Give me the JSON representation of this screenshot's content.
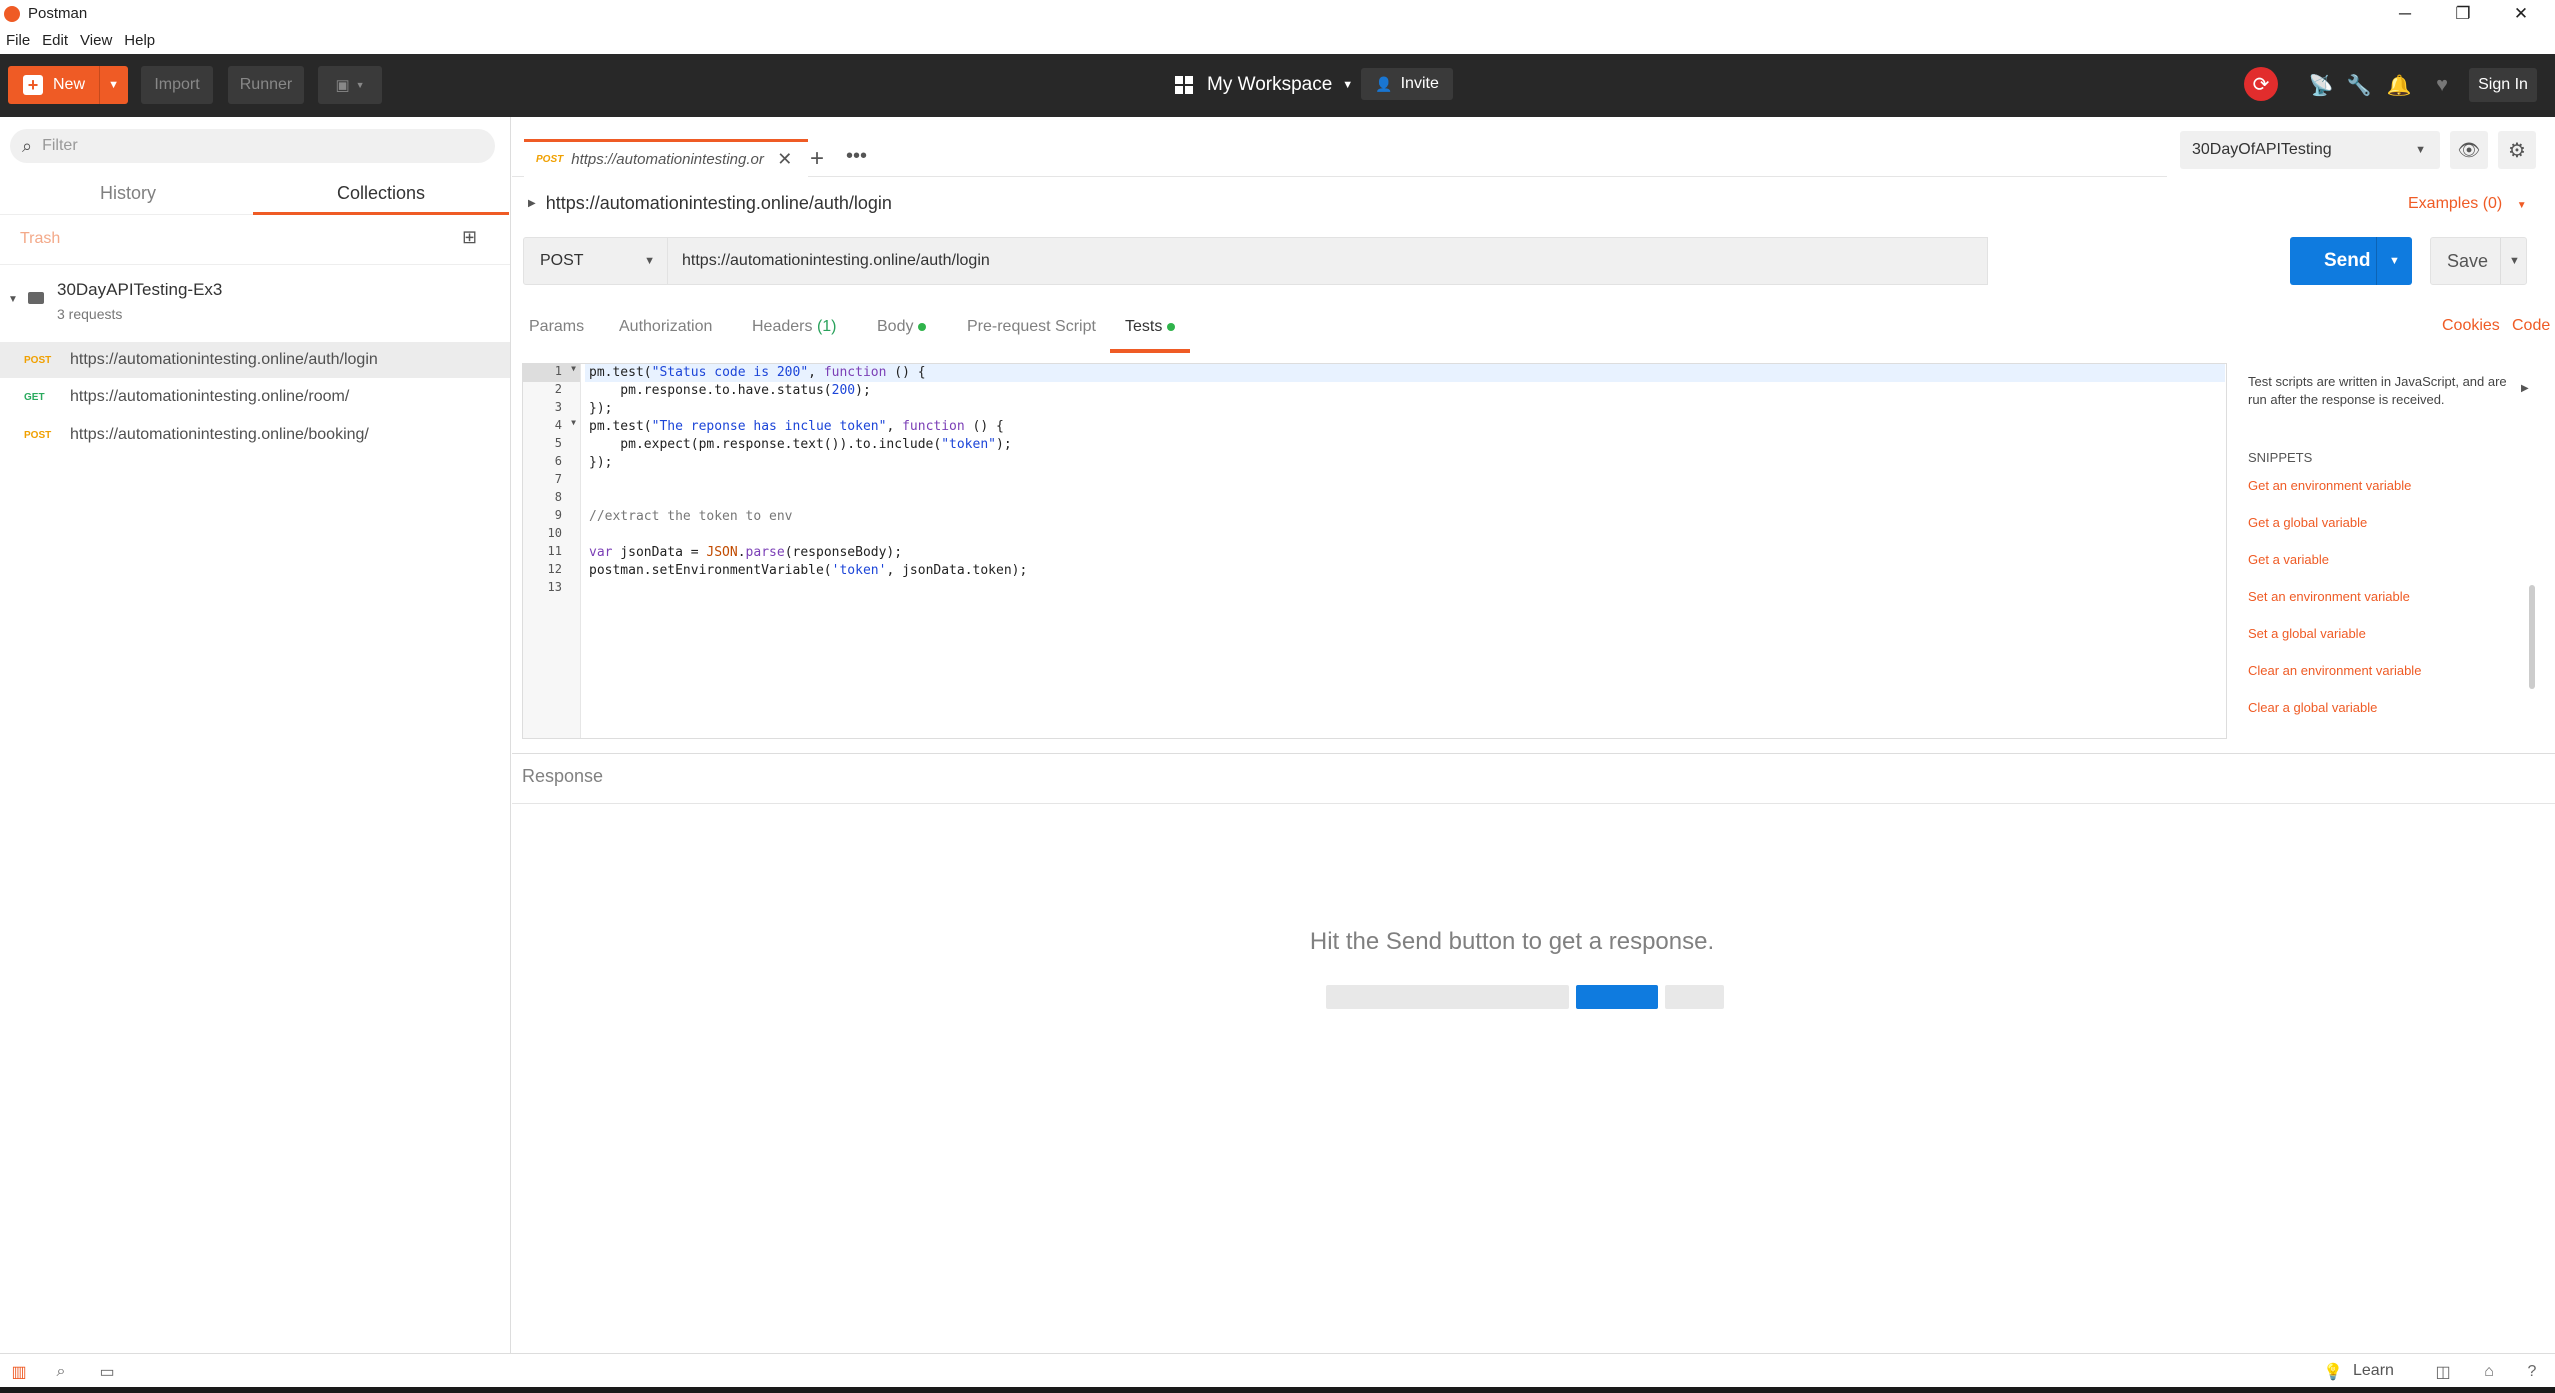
{
  "window": {
    "title": "Postman",
    "minimize": "─",
    "maximize": "❐",
    "close": "✕"
  },
  "menu": [
    "File",
    "Edit",
    "View",
    "Help"
  ],
  "header": {
    "new_label": "New",
    "import_label": "Import",
    "runner_label": "Runner",
    "workspace_label": "My Workspace",
    "invite_label": "Invite",
    "signin_label": "Sign In"
  },
  "sidebar": {
    "filter_placeholder": "Filter",
    "tabs": [
      "History",
      "Collections"
    ],
    "active_tab": "Collections",
    "trash_label": "Trash",
    "collection": {
      "name": "30DayAPITesting-Ex3",
      "count": "3 requests"
    },
    "requests": [
      {
        "method": "POST",
        "url": "https://automationintesting.online/auth/login"
      },
      {
        "method": "GET",
        "url": "https://automationintesting.online/room/"
      },
      {
        "method": "POST",
        "url": "https://automationintesting.online/booking/"
      }
    ]
  },
  "main": {
    "tab": {
      "method": "POST",
      "title": "https://automationintesting.or"
    },
    "environment": "30DayOfAPITesting",
    "request_title": "https://automationintesting.online/auth/login",
    "examples_label": "Examples (0)",
    "method": "POST",
    "url": "https://automationintesting.online/auth/login",
    "send_label": "Send",
    "save_label": "Save",
    "request_tabs": {
      "params": "Params",
      "authorization": "Authorization",
      "headers": "Headers",
      "headers_count": "(1)",
      "body": "Body",
      "prerequest": "Pre-request Script",
      "tests": "Tests"
    },
    "cookies_label": "Cookies",
    "code_label": "Code",
    "line_numbers": [
      "1",
      "2",
      "3",
      "4",
      "5",
      "6",
      "7",
      "8",
      "9",
      "10",
      "11",
      "12",
      "13"
    ]
  },
  "snippets": {
    "help_text": "Test scripts are written in JavaScript, and are run after the response is received.",
    "title": "SNIPPETS",
    "items": [
      "Get an environment variable",
      "Get a global variable",
      "Get a variable",
      "Set an environment variable",
      "Set a global variable",
      "Clear an environment variable",
      "Clear a global variable"
    ]
  },
  "response": {
    "title": "Response",
    "empty_text": "Hit the Send button to get a response."
  },
  "statusbar": {
    "learn_label": "Learn"
  },
  "colors": {
    "accent": "#ef5b25",
    "send": "#0f7bdf",
    "header_bg": "#282828"
  }
}
